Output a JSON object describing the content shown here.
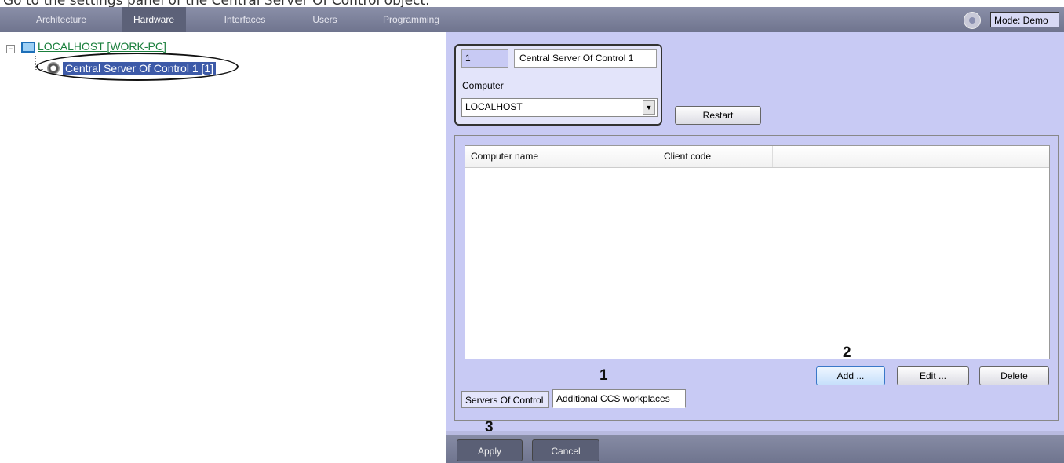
{
  "caption": "Go to the settings panel of the Central Server Of Control object.",
  "tabs": [
    {
      "label": "Architecture"
    },
    {
      "label": "Hardware"
    },
    {
      "label": "Interfaces"
    },
    {
      "label": "Users"
    },
    {
      "label": "Programming"
    }
  ],
  "mode": {
    "label": "Mode: Demo"
  },
  "tree": {
    "expander": "−",
    "root": "LOCALHOST [WORK-PC]",
    "child": "Central Server Of Control 1 [1]"
  },
  "settings": {
    "id_value": "1",
    "name_value": "Central Server Of Control 1",
    "computer_label": "Computer",
    "computer_value": "LOCALHOST",
    "dropdown_arrow": "▼",
    "restart_label": "Restart"
  },
  "grid": {
    "columns": [
      "Computer name",
      "Client code"
    ]
  },
  "buttons": {
    "add": "Add ...",
    "edit": "Edit ...",
    "delete": "Delete"
  },
  "subtabs": [
    "Servers Of Control",
    "Additional CCS workplaces"
  ],
  "markers": [
    "1",
    "2",
    "3"
  ],
  "footer": {
    "apply": "Apply",
    "cancel": "Cancel"
  },
  "colors": {
    "panel_bg": "#c8caf4",
    "toolbar": "#7c8199",
    "selection": "#3d5aa8",
    "tree_link": "#1a7f3c"
  }
}
